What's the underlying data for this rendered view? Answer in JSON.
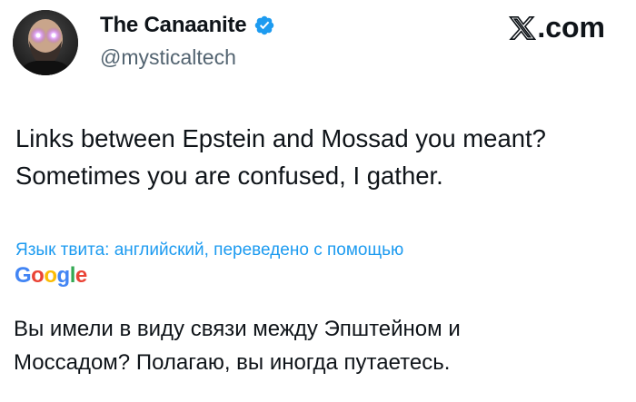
{
  "author": {
    "display_name": "The Canaanite",
    "handle": "@mysticaltech",
    "avatar_icon": "profile-photo-glowing-eyes",
    "verified_icon": "verified-badge-icon",
    "verified_color": "#1d9bf0"
  },
  "site": {
    "logo_icon": "x-logo-icon",
    "domain_suffix": ".com"
  },
  "tweet": {
    "lines": [
      "Links between Epstein and Mossad you meant?",
      "Sometimes you are confused, I gather."
    ]
  },
  "translation": {
    "note": "Язык твита: английский, переведено с помощью",
    "provider_letters": [
      "G",
      "o",
      "o",
      "g",
      "l",
      "e"
    ],
    "provider_colors": [
      "#4285f4",
      "#ea4335",
      "#fbbc05",
      "#4285f4",
      "#34a853",
      "#ea4335"
    ],
    "lines": [
      "Вы имели в виду связи между Эпштейном и",
      "Моссадом? Полагаю, вы иногда путаетесь."
    ],
    "link_color": "#1d9bf0"
  }
}
